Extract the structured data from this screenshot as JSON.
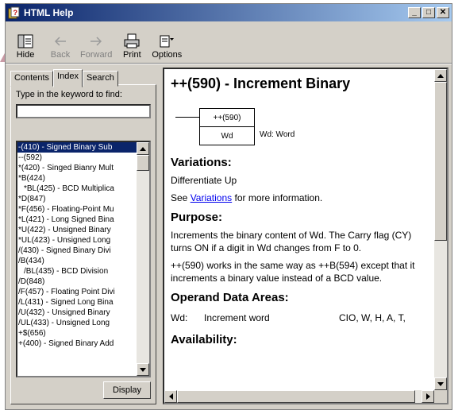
{
  "window": {
    "title": "HTML Help"
  },
  "window_controls": {
    "minimize": "_",
    "maximize": "□",
    "close": "✕"
  },
  "toolbar": {
    "hide": "Hide",
    "back": "Back",
    "forward": "Forward",
    "print": "Print",
    "options": "Options"
  },
  "tabs": {
    "contents": "Contents",
    "index": "Index",
    "search": "Search"
  },
  "index_panel": {
    "keyword_label": "Type in the keyword to find:",
    "keyword_value": "",
    "items": [
      "-(410) - Signed Binary Sub",
      "--(592)",
      "*(420) - Singed Bianry Mult",
      "*B(424)",
      "*BL(425) - BCD Multiplica",
      "*D(847)",
      "*F(456) - Floating-Point Mu",
      "*L(421) - Long Signed Bina",
      "*U(422) - Unsigned Binary",
      "*UL(423) - Unsigned Long",
      "/(430) - Signed Binary Divi",
      "/B(434)",
      "/BL(435) - BCD Division",
      "/D(848)",
      "/F(457) - Floating Point Divi",
      "/L(431) - Signed Long Bina",
      "/U(432) - Unsigned Binary",
      "/UL(433) - Unsigned Long",
      "+$(656)",
      "+(400) - Signed Binary Add"
    ],
    "display_button": "Display"
  },
  "document": {
    "title": "++(590) - Increment Binary",
    "diagram": {
      "box_top": "++(590)",
      "box_bottom": "Wd",
      "desc": "Wd: Word"
    },
    "variations_heading": "Variations:",
    "variations_text": "Differentiate Up",
    "see_prefix": "See ",
    "see_link": "Variations",
    "see_suffix": " for more information.",
    "purpose_heading": "Purpose:",
    "purpose_p1": "Increments the binary content of Wd. The Carry flag (CY) turns ON if a digit in Wd changes from F to 0.",
    "purpose_p2": "++(590) works in the same way as ++B(594) except that it increments a binary value instead of a BCD value.",
    "operand_heading": "Operand Data Areas:",
    "operand_row": {
      "name": "Wd:",
      "desc": "Increment word",
      "areas": "CIO, W, H, A, T,"
    },
    "availability_heading": "Availability:"
  },
  "colors": {
    "titlebar": "#0a246a",
    "selection": "#0a246a",
    "link": "#0000ee",
    "face": "#d4d0c8"
  }
}
